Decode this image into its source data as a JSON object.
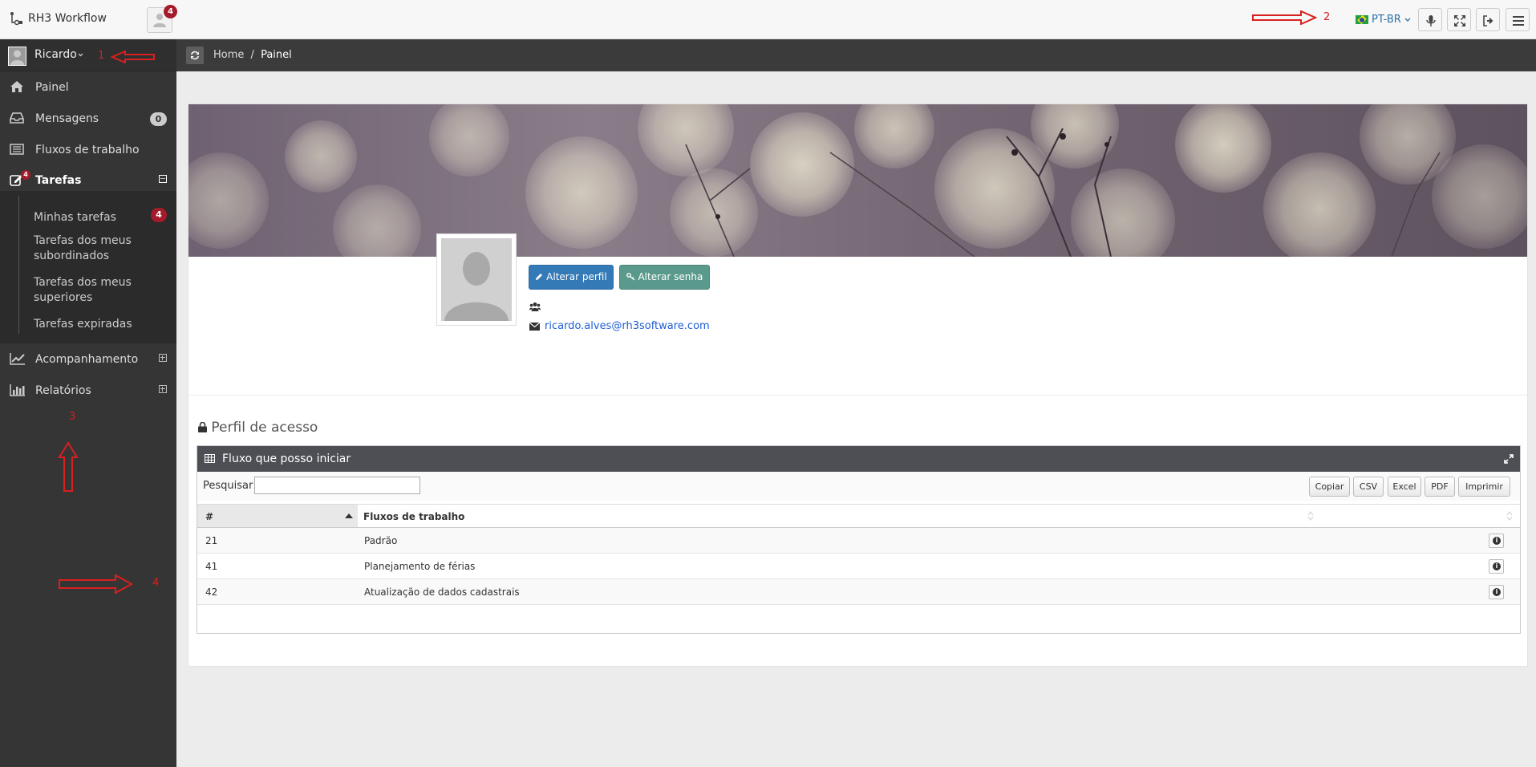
{
  "app": {
    "title": "RH3 Workflow",
    "notifications_count": "4"
  },
  "header": {
    "language": "PT-BR"
  },
  "annotations": [
    "1",
    "2",
    "3",
    "4"
  ],
  "sidebar": {
    "user": "Ricardo",
    "items": [
      {
        "label": "Painel"
      },
      {
        "label": "Mensagens",
        "count": "0"
      },
      {
        "label": "Fluxos de trabalho"
      },
      {
        "label": "Tarefas",
        "badge": "4"
      },
      {
        "label": "Acompanhamento"
      },
      {
        "label": "Relatórios"
      }
    ],
    "tarefas_sub": [
      {
        "label": "Minhas tarefas",
        "count": "4"
      },
      {
        "label": "Tarefas dos meus subordinados"
      },
      {
        "label": "Tarefas dos meus superiores"
      },
      {
        "label": "Tarefas expiradas"
      }
    ]
  },
  "breadcrumb": {
    "home": "Home",
    "separator": "/",
    "current": "Painel"
  },
  "profile": {
    "edit_button": "Alterar perfil",
    "password_button": "Alterar senha",
    "email": "ricardo.alves@rh3software.com"
  },
  "access": {
    "section_title": "Perfil de acesso",
    "panel_title": "Fluxo que posso iniciar",
    "search_label": "Pesquisar",
    "search_value": "",
    "export_buttons": [
      "Copiar",
      "CSV",
      "Excel",
      "PDF",
      "Imprimir"
    ],
    "columns": [
      "#",
      "Fluxos de trabalho"
    ],
    "rows": [
      {
        "id": "21",
        "name": "Padrão"
      },
      {
        "id": "41",
        "name": "Planejamento de férias"
      },
      {
        "id": "42",
        "name": "Atualização de dados cadastrais"
      }
    ]
  }
}
